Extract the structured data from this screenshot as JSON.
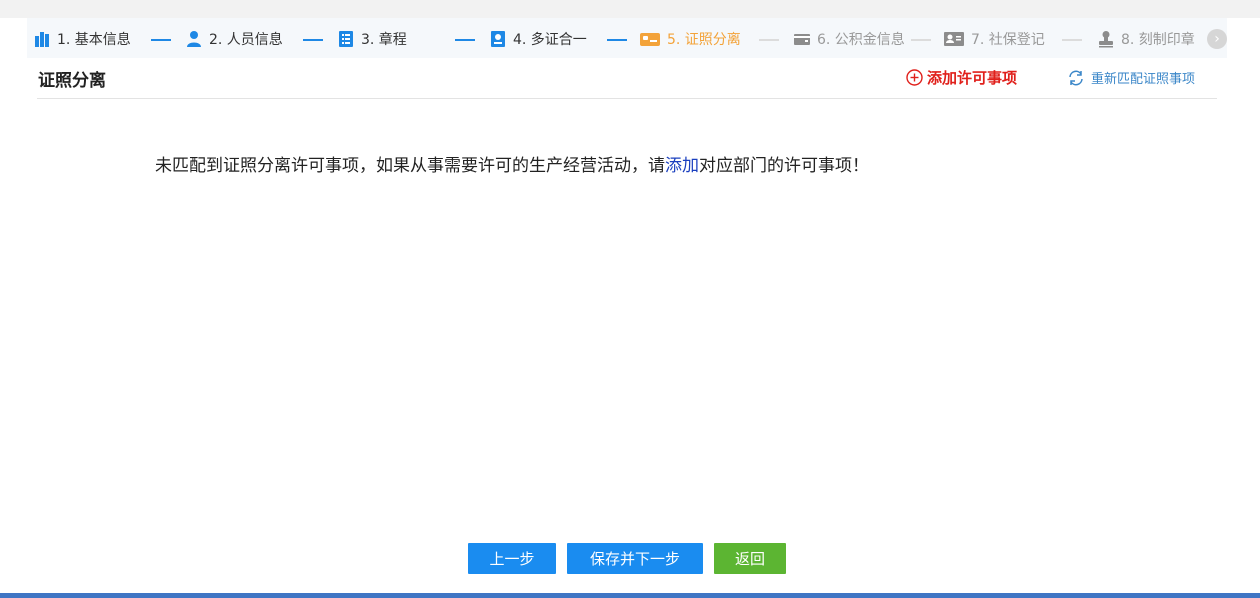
{
  "steps": [
    {
      "label": "1. 基本信息",
      "icon": "building-icon",
      "state": "done"
    },
    {
      "label": "2. 人员信息",
      "icon": "person-icon",
      "state": "done"
    },
    {
      "label": "3. 章程",
      "icon": "list-icon",
      "state": "done"
    },
    {
      "label": "4. 多证合一",
      "icon": "badge-icon",
      "state": "done"
    },
    {
      "label": "5. 证照分离",
      "icon": "card-icon",
      "state": "active"
    },
    {
      "label": "6. 公积金信息",
      "icon": "wallet-icon",
      "state": "todo"
    },
    {
      "label": "7. 社保登记",
      "icon": "id-card-icon",
      "state": "todo"
    },
    {
      "label": "8. 刻制印章",
      "icon": "stamp-icon",
      "state": "todo"
    }
  ],
  "header": {
    "title": "证照分离",
    "add_label": "添加许可事项",
    "rematch_label": "重新匹配证照事项"
  },
  "message": {
    "before": "未匹配到证照分离许可事项，如果从事需要许可的生产经营活动，请",
    "link": "添加",
    "after": "对应部门的许可事项！"
  },
  "footer": {
    "prev_label": "上一步",
    "save_label": "保存并下一步",
    "back_label": "返回"
  },
  "colors": {
    "done": "#1e88e5",
    "active": "#f3a33a",
    "todo": "#999999",
    "add": "#e0201b",
    "primary_button": "#1a8cf0",
    "back_button": "#5cb532"
  }
}
